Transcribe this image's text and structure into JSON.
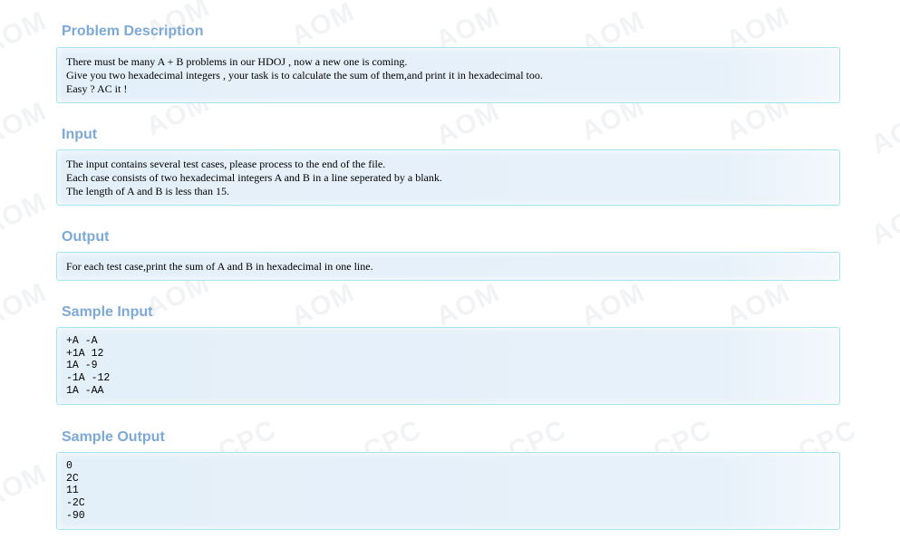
{
  "watermark": {
    "marks": [
      "AOM",
      "AOM",
      "AOM",
      "AOM",
      "AOM",
      "AOM",
      "AOM",
      "AOM",
      "AOM",
      "AOM",
      "AOM",
      "AOM",
      "AOM",
      "AOM",
      "AOM",
      "AOM",
      "AOM",
      "AOM",
      "AOM",
      "AOM",
      "AOM",
      "CPC",
      "CPC",
      "CPC",
      "CPC",
      "CPC"
    ]
  },
  "sections": {
    "description": {
      "title": "Problem Description",
      "lines": [
        "There must be many A + B problems in our HDOJ , now a new one is coming.",
        "Give you two hexadecimal integers , your task is to calculate the sum of them,and print it in hexadecimal too.",
        "Easy ? AC it !"
      ]
    },
    "input": {
      "title": "Input",
      "lines": [
        "The input contains several test cases, please process to the end of the file.",
        "Each case consists of two hexadecimal integers A and B in a line seperated by a blank.",
        "The length of A and B is less than 15."
      ]
    },
    "output": {
      "title": "Output",
      "lines": [
        "For each test case,print the sum of A and B in hexadecimal in one line."
      ]
    },
    "sample_input": {
      "title": "Sample Input",
      "text": "+A -A\n+1A 12\n1A -9\n-1A -12\n1A -AA"
    },
    "sample_output": {
      "title": "Sample Output",
      "text": "0\n2C\n11\n-2C\n-90"
    }
  }
}
